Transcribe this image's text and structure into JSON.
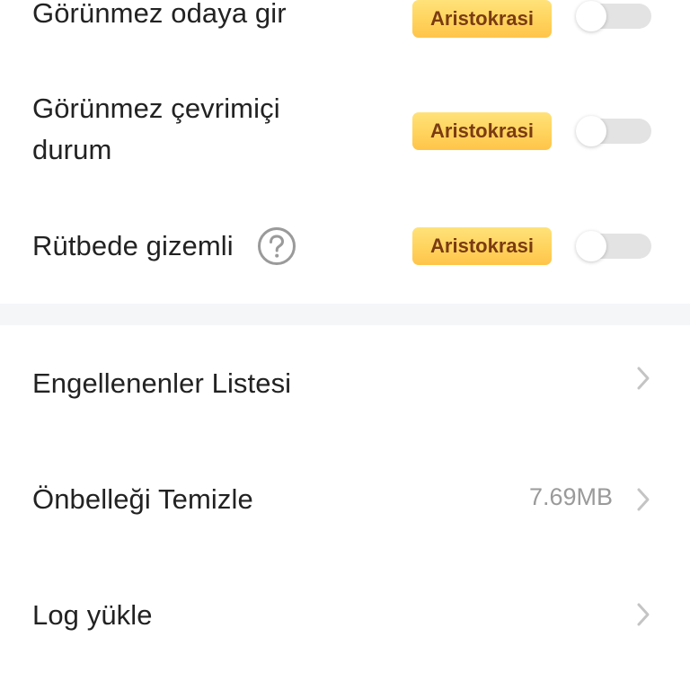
{
  "privacy_settings": {
    "items": [
      {
        "label": "Görünmez odaya gir",
        "badge": "Aristokrasi",
        "enabled": false
      },
      {
        "label_line1": "Görünmez çevrimiçi",
        "label_line2": "durum",
        "badge": "Aristokrasi",
        "enabled": false
      },
      {
        "label": "Rütbede gizemli",
        "badge": "Aristokrasi",
        "enabled": false,
        "help_icon": "question-circle-icon"
      }
    ]
  },
  "general_settings": {
    "items": [
      {
        "label": "Engellenenler Listesi",
        "icon": "chevron-right-icon"
      },
      {
        "label": "Önbelleği Temizle",
        "value": "7.69MB",
        "icon": "chevron-right-icon"
      },
      {
        "label": "Log yükle",
        "icon": "chevron-right-icon"
      }
    ]
  },
  "colors": {
    "badge_text": "#7a3b12",
    "badge_bg": "#ffd35c",
    "toggle_off_track": "#e3e3e3",
    "section_divider": "#f5f6f8",
    "value_text": "#9a9a9a"
  }
}
